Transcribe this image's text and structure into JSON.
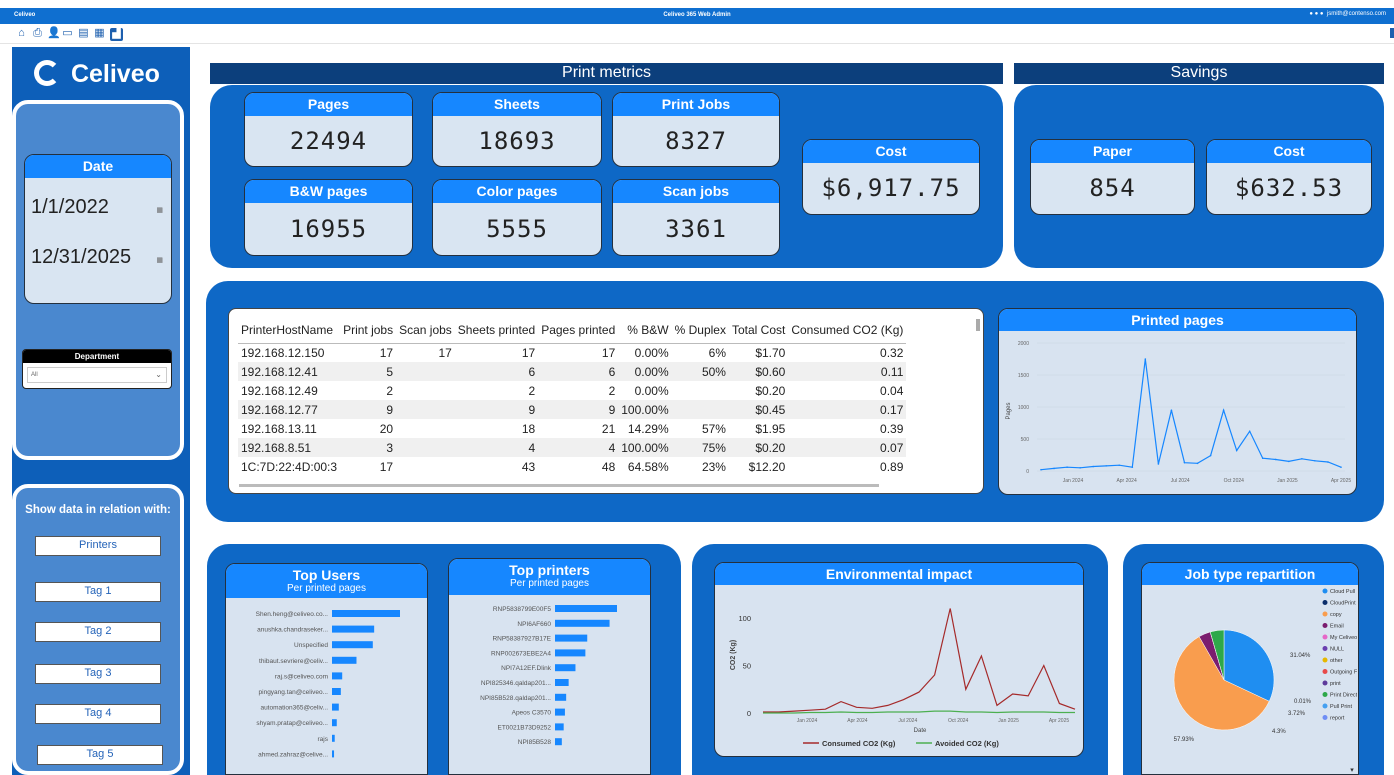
{
  "app": {
    "name": "Celiveo",
    "window_title": "Celiveo 365 Web Admin",
    "user": "jsmith@contenso.com",
    "logo_text": "Celiveo"
  },
  "colors": {
    "accent": "#1687ff",
    "dark_header": "#0c3f7c",
    "panel": "#0e68c6"
  },
  "toolbar": {
    "icons": [
      "home-icon",
      "printer-icon",
      "user-icon",
      "monitor-icon",
      "device-icon",
      "report-icon",
      "chart-icon"
    ]
  },
  "date_filter": {
    "label": "Date",
    "start": "1/1/2022",
    "end": "12/31/2025"
  },
  "department": {
    "label": "Department",
    "value": "All"
  },
  "relation": {
    "label": "Show data in relation with:",
    "buttons": [
      "Printers",
      "Tag 1",
      "Tag 2",
      "Tag 3",
      "Tag 4",
      "Tag 5"
    ]
  },
  "print_metrics": {
    "title": "Print metrics",
    "cards": [
      {
        "label": "Pages",
        "value": "22494"
      },
      {
        "label": "Sheets",
        "value": "18693"
      },
      {
        "label": "Print Jobs",
        "value": "8327"
      },
      {
        "label": "B&W pages",
        "value": "16955"
      },
      {
        "label": "Color pages",
        "value": "5555"
      },
      {
        "label": "Scan jobs",
        "value": "3361"
      }
    ],
    "cost": {
      "label": "Cost",
      "value": "$6,917.75"
    }
  },
  "savings": {
    "title": "Savings",
    "paper": {
      "label": "Paper",
      "value": "854"
    },
    "cost": {
      "label": "Cost",
      "value": "$632.53"
    }
  },
  "printer_table": {
    "columns": [
      "PrinterHostName",
      "Print jobs",
      "Scan jobs",
      "Sheets printed",
      "Pages printed",
      "% B&W",
      "% Duplex",
      "Total Cost",
      "Consumed CO2 (Kg)"
    ],
    "rows": [
      [
        "192.168.12.150",
        "17",
        "17",
        "17",
        "17",
        "0.00%",
        "6%",
        "$1.70",
        "0.32"
      ],
      [
        "192.168.12.41",
        "5",
        "",
        "6",
        "6",
        "0.00%",
        "50%",
        "$0.60",
        "0.11"
      ],
      [
        "192.168.12.49",
        "2",
        "",
        "2",
        "2",
        "0.00%",
        "",
        "$0.20",
        "0.04"
      ],
      [
        "192.168.12.77",
        "9",
        "",
        "9",
        "9",
        "100.00%",
        "",
        "$0.45",
        "0.17"
      ],
      [
        "192.168.13.11",
        "20",
        "",
        "18",
        "21",
        "14.29%",
        "57%",
        "$1.95",
        "0.39"
      ],
      [
        "192.168.8.51",
        "3",
        "",
        "4",
        "4",
        "100.00%",
        "75%",
        "$0.20",
        "0.07"
      ],
      [
        "1C:7D:22:4D:00:3",
        "17",
        "",
        "43",
        "48",
        "64.58%",
        "23%",
        "$12.20",
        "0.89"
      ]
    ]
  },
  "chart_data": [
    {
      "type": "line",
      "title": "Printed pages",
      "xlabel": "",
      "ylabel": "Pages",
      "ylim": [
        0,
        2000
      ],
      "yticks": [
        "0",
        "500",
        "1000",
        "1500",
        "2000"
      ],
      "xticks": [
        "Jan 2024",
        "Apr 2024",
        "Jul 2024",
        "Oct 2024",
        "Jan 2025",
        "Apr 2025"
      ],
      "x": [
        "2023-10",
        "2023-11",
        "2023-12",
        "2024-01",
        "2024-02",
        "2024-03",
        "2024-04",
        "2024-05",
        "2024-05-20",
        "2024-06",
        "2024-06-15",
        "2024-07",
        "2024-08",
        "2024-09",
        "2024-09-25",
        "2024-10",
        "2024-10-15",
        "2024-11",
        "2024-12",
        "2025-01",
        "2025-02",
        "2025-03",
        "2025-04",
        "2025-04-20"
      ],
      "values": [
        20,
        40,
        60,
        50,
        70,
        80,
        90,
        60,
        1750,
        110,
        950,
        130,
        120,
        240,
        950,
        320,
        620,
        200,
        180,
        150,
        190,
        160,
        140,
        60
      ]
    },
    {
      "type": "bar",
      "title": "Top Users",
      "subtitle": "Per printed pages",
      "categories": [
        "Shen.heng@celiveo.co...",
        "anushka.chandraseker...",
        "Unspecified",
        "thibaut.sevriere@celiv...",
        "raj.s@celiveo.com",
        "pingyang.tan@celiveo...",
        "automation365@celiv...",
        "shyam.pratap@celiveo...",
        "rajs",
        "ahmed.zahraz@celive..."
      ],
      "values": [
        100,
        62,
        60,
        36,
        15,
        13,
        10,
        7,
        4,
        3
      ]
    },
    {
      "type": "bar",
      "title": "Top printers",
      "subtitle": "Per printed pages",
      "categories": [
        "RNP5838799E00F5",
        "NPI6AF660",
        "RNP58387927B17E",
        "RNP002673EBE2A4",
        "NPI7A12EF.Dlink",
        "NPI825346.qaldap201...",
        "NPI85B528.qaldap201...",
        "Apeos C3570",
        "ET0021B73D9252",
        "NPI85B528"
      ],
      "values": [
        100,
        88,
        52,
        49,
        33,
        22,
        18,
        16,
        14,
        11
      ]
    },
    {
      "type": "line",
      "title": "Environmental impact",
      "xlabel": "Date",
      "ylabel": "CO2 (Kg)",
      "ylim": [
        0,
        120
      ],
      "yticks": [
        "0",
        "50",
        "100"
      ],
      "xticks": [
        "Jan 2024",
        "Apr 2024",
        "Jul 2024",
        "Oct 2024",
        "Jan 2025",
        "Apr 2025"
      ],
      "x": [
        "2023-10",
        "2023-12",
        "2024-02",
        "2024-04",
        "2024-05",
        "2024-06",
        "2024-07",
        "2024-08",
        "2024-09",
        "2024-10",
        "2024-10-20",
        "2024-11",
        "2024-11-10",
        "2024-11-20",
        "2024-12",
        "2025-01",
        "2025-02",
        "2025-03",
        "2025-03-20",
        "2025-04",
        "2025-04-20"
      ],
      "series": [
        {
          "name": "Consumed CO2 (Kg)",
          "color": "#a52a2a",
          "values": [
            1,
            1,
            2,
            3,
            4,
            12,
            6,
            5,
            8,
            14,
            22,
            40,
            110,
            25,
            60,
            8,
            20,
            18,
            50,
            10,
            4
          ]
        },
        {
          "name": "Avoided CO2 (Kg)",
          "color": "#4caf50",
          "values": [
            0,
            0,
            0,
            0.5,
            0.5,
            1,
            0.5,
            0.5,
            1,
            1,
            1,
            2,
            2,
            1,
            1,
            0.5,
            1,
            1,
            1,
            0.5,
            0.5
          ]
        }
      ]
    },
    {
      "type": "pie",
      "title": "Job type repartition",
      "categories": [
        "Cloud Pull Print",
        "CloudPrint",
        "copy",
        "Email",
        "My Celiveo",
        "NULL",
        "other",
        "Outgoing Fax",
        "print",
        "Print Direct",
        "Pull Print",
        "report"
      ],
      "colors": [
        "#1f8ef1",
        "#0b2e6b",
        "#f99d4e",
        "#7b1d6f",
        "#e667c8",
        "#6a3fb0",
        "#e6b800",
        "#e84a4a",
        "#5d3a9b",
        "#2ea84a",
        "#46a0f0",
        "#6f8ef5"
      ],
      "values": [
        31.04,
        0,
        57.93,
        3.72,
        0,
        0,
        0,
        0,
        0.01,
        4.3,
        0,
        0
      ],
      "labels": [
        "31.04%",
        "57.93%",
        "3.72%",
        "4.3%",
        "0.01%"
      ]
    }
  ]
}
